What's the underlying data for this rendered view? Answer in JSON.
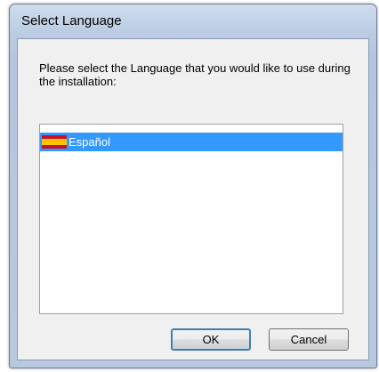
{
  "window": {
    "title": "Select Language"
  },
  "dialog": {
    "prompt": "Please select the Language that you would like to use during the installation:"
  },
  "language_list": {
    "items": [
      {
        "label": "Español",
        "icon": "spain-flag-icon",
        "selected": true
      }
    ]
  },
  "buttons": {
    "ok_label": "OK",
    "cancel_label": "Cancel"
  },
  "colors": {
    "selection": "#3399ff",
    "dialog_background": "#f0f0f0",
    "titlebar": "#bccde3"
  }
}
